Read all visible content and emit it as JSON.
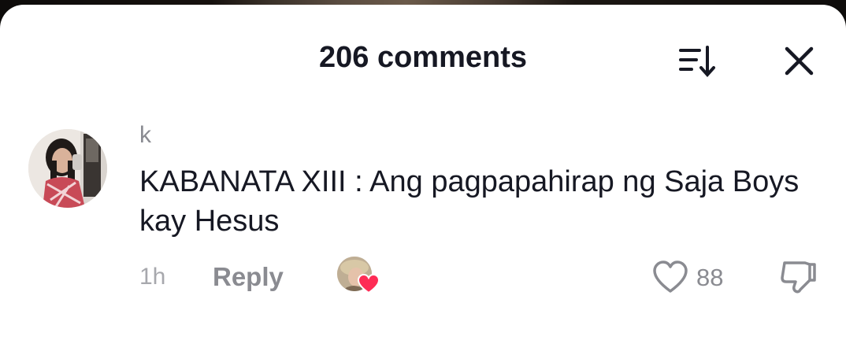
{
  "header": {
    "title": "206 comments",
    "sort_icon": "sort-descending-icon",
    "close_icon": "close-icon"
  },
  "comment": {
    "avatar_icon": "user-avatar",
    "username": "k",
    "text": "KABANATA XIII : Ang pagpapahirap ng Saja Boys kay Hesus",
    "time": "1h",
    "reply_label": "Reply",
    "creator_liked_icon": "creator-liked-heart-icon",
    "like_icon": "heart-outline-icon",
    "like_count": "88",
    "dislike_icon": "thumbs-down-icon"
  },
  "colors": {
    "text_primary": "#161823",
    "text_secondary": "#8a8b91",
    "heart_red": "#fe2c55",
    "background": "#ffffff"
  }
}
